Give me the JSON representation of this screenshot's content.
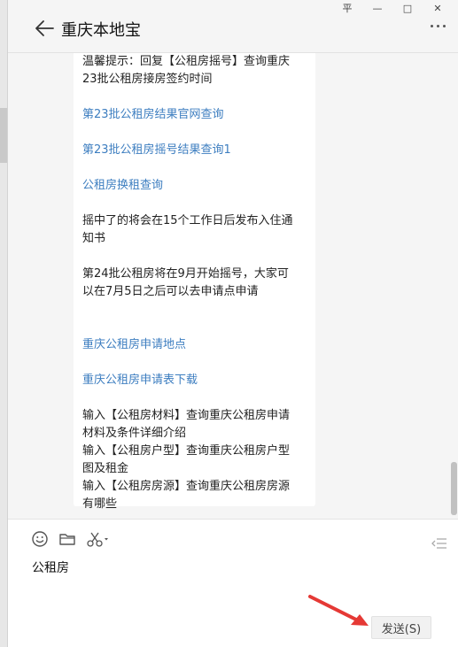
{
  "window": {
    "controls": {
      "pin": "平",
      "minimize": "—",
      "maximize": "□",
      "close": "✕"
    }
  },
  "header": {
    "title": "重庆本地宝"
  },
  "message": {
    "lines": [
      {
        "text": "温馨提示：回复【公租房摇号】查询重庆",
        "link": false
      },
      {
        "text": "23批公租房接房签约时间",
        "link": false
      },
      {
        "text": "第23批公租房结果官网查询",
        "link": true
      },
      {
        "text": "第23批公租房摇号结果查询1",
        "link": true
      },
      {
        "text": "公租房换租查询",
        "link": true
      },
      {
        "text": "摇中了的将会在15个工作日后发布入住通",
        "link": false
      },
      {
        "text": "知书",
        "link": false
      },
      {
        "text": "第24批公租房将在9月开始摇号，大家可",
        "link": false
      },
      {
        "text": "以在7月5日之后可以去申请点申请",
        "link": false
      },
      {
        "text": "重庆公租房申请地点",
        "link": true
      },
      {
        "text": "重庆公租房申请表下载",
        "link": true
      },
      {
        "text": "输入【公租房材料】查询重庆公租房申请",
        "link": false
      },
      {
        "text": "材料及条件详细介绍",
        "link": false
      },
      {
        "text": "输入【公租房户型】查询重庆公租房户型",
        "link": false
      },
      {
        "text": "图及租金",
        "link": false
      },
      {
        "text": "输入【公租房房源】查询重庆公租房房源",
        "link": false
      },
      {
        "text": "有哪些",
        "link": false
      }
    ]
  },
  "composer": {
    "input_value": "公租房",
    "send_label": "发送(S)",
    "icons": [
      "emoji-icon",
      "folder-icon",
      "scissors-icon",
      "chat-history-icon"
    ]
  },
  "colors": {
    "link": "#3d7ec0",
    "arrow": "#e53935",
    "background": "#f5f5f5"
  }
}
